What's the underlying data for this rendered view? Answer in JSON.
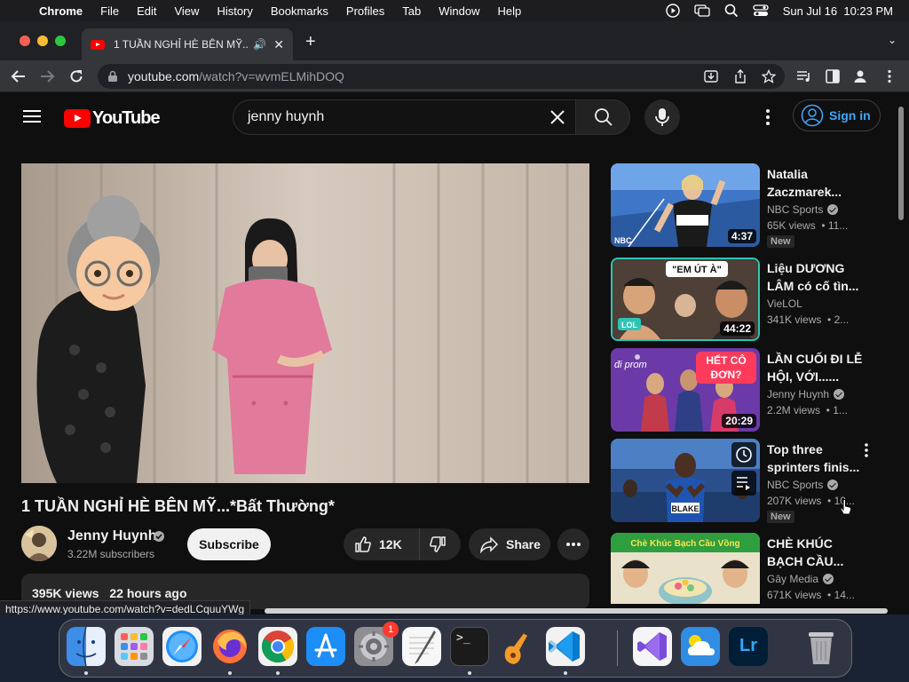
{
  "menubar": {
    "app": "Chrome",
    "items": [
      "File",
      "Edit",
      "View",
      "History",
      "Bookmarks",
      "Profiles",
      "Tab",
      "Window",
      "Help"
    ],
    "clock": "Sun Jul 16  10:23 PM"
  },
  "tab": {
    "title": "1 TUẦN NGHỈ HÈ BÊN MỸ..."
  },
  "address": {
    "host": "youtube.com",
    "path": "/watch?v=wvmELMihDOQ"
  },
  "yt": {
    "logo": "YouTube",
    "search_value": "jenny huynh",
    "sign_in": "Sign in"
  },
  "video": {
    "title": "1 TUẦN NGHỈ HÈ BÊN MỸ...*Bất Thường*",
    "channel": "Jenny Huynh",
    "subscribers": "3.22M subscribers",
    "subscribe": "Subscribe",
    "likes": "12K",
    "share": "Share",
    "views": "395K views",
    "age": "22 hours ago"
  },
  "recs": [
    {
      "title_l1": "Natalia",
      "title_l2": "Zaczmarek...",
      "channel": "NBC Sports",
      "meta": "65K views  • 11...",
      "duration": "4:37",
      "badge": "New"
    },
    {
      "title_l1": "Liệu DƯƠNG",
      "title_l2": "LÂM có cố tìn...",
      "channel": "VieLOL",
      "meta": "341K views  • 2...",
      "duration": "44:22",
      "badge": ""
    },
    {
      "title_l1": "LẦN CUỐI ĐI LỄ",
      "title_l2": "HỘI, VỚI......",
      "channel": "Jenny Huynh",
      "meta": "2.2M views  • 1...",
      "duration": "20:29",
      "badge": ""
    },
    {
      "title_l1": "Top three",
      "title_l2": "sprinters finis...",
      "channel": "NBC Sports",
      "meta": "207K views  • 10...",
      "duration": "",
      "badge": "New"
    },
    {
      "title_l1": "CHÈ KHÚC",
      "title_l2": "BẠCH CẦU...",
      "channel": "Gây Media",
      "meta": "671K views  • 14...",
      "duration": "",
      "badge": ""
    }
  ],
  "thumb_text": {
    "r2_banner": "\"EM ÚT À\"",
    "r2_lol": "LOL",
    "r3_banner_1": "HẾT CÔ",
    "r3_banner_2": "ĐƠN?",
    "r3_small": "đi prom",
    "r4_name": "BLAKE",
    "r5_banner": "Chè Khúc Bạch Cầu Vồng"
  },
  "status_url": "https://www.youtube.com/watch?v=dedLCquuYWg",
  "dock": {
    "badge_settings": "1",
    "items": [
      "Finder",
      "Launchpad",
      "Safari",
      "Firefox",
      "Chrome",
      "App Store",
      "System Settings",
      "TextEdit",
      "Terminal",
      "GarageBand",
      "VS Code",
      "Visual Studio",
      "Weather",
      "Lightroom",
      "Trash"
    ],
    "terminal_glyph": ">_",
    "lightroom_glyph": "Lr"
  },
  "colors": {
    "yt_red": "#ff0000",
    "link_blue": "#3ea6ff",
    "bg": "#0f0f0f"
  }
}
